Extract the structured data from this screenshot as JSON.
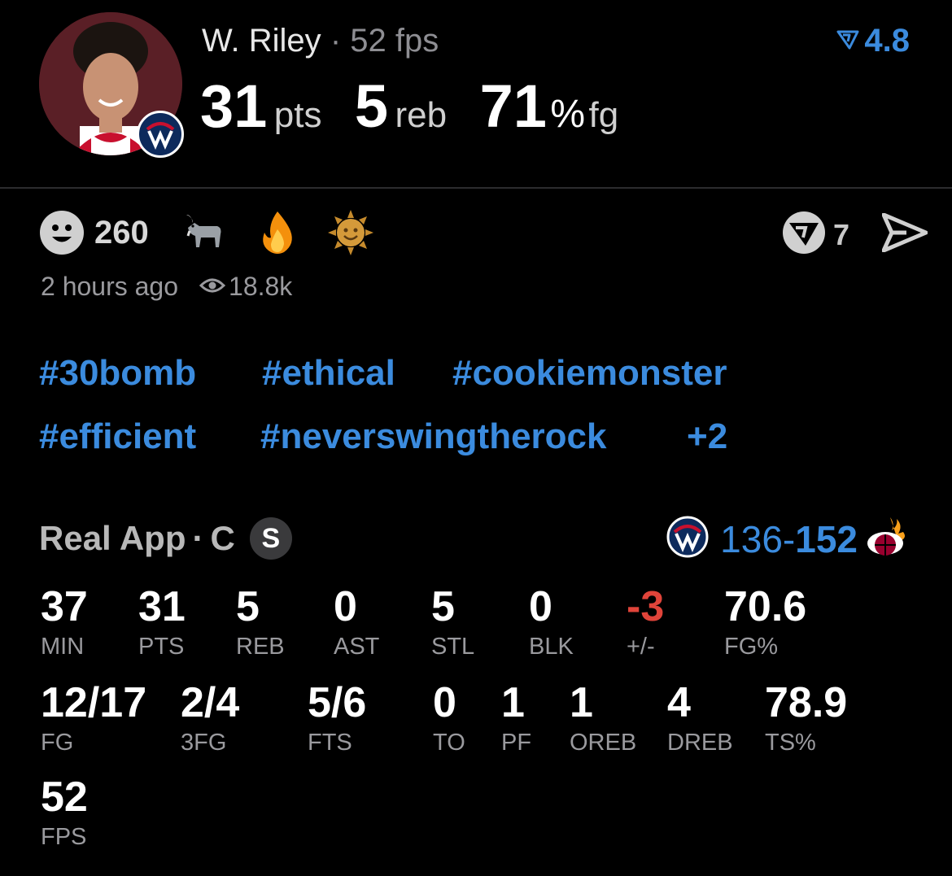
{
  "player": {
    "name": "W. Riley",
    "dot": "·",
    "fps": "52 fps",
    "rating": "4.8",
    "stats": [
      {
        "value": "31",
        "unit": "pts"
      },
      {
        "value": "5",
        "unit": "reb"
      },
      {
        "value": "71",
        "unit": "%",
        "suffix": "fg"
      }
    ]
  },
  "reactions": {
    "count": "260",
    "emojis": [
      "goat-icon",
      "fire-icon",
      "sun-icon"
    ],
    "comments": "7"
  },
  "meta": {
    "time": "2 hours ago",
    "views": "18.8k"
  },
  "tags": [
    "#30bomb",
    "#ethical",
    "#cookiemonster",
    "#efficient",
    "#neverswingtherock",
    "+2"
  ],
  "game": {
    "source": "Real App",
    "dot": "·",
    "position": "C",
    "badge": "S",
    "team_score": "136",
    "dash": "-",
    "opp_score": "152"
  },
  "box_row1": [
    {
      "value": "37",
      "label": "MIN"
    },
    {
      "value": "31",
      "label": "PTS"
    },
    {
      "value": "5",
      "label": "REB"
    },
    {
      "value": "0",
      "label": "AST"
    },
    {
      "value": "5",
      "label": "STL"
    },
    {
      "value": "0",
      "label": "BLK"
    },
    {
      "value": "-3",
      "label": "+/-"
    },
    {
      "value": "70.6",
      "label": "FG%"
    }
  ],
  "box_row2": [
    {
      "value": "12/17",
      "label": "FG"
    },
    {
      "value": "2/4",
      "label": "3FG"
    },
    {
      "value": "5/6",
      "label": "FTS"
    },
    {
      "value": "0",
      "label": "TO"
    },
    {
      "value": "1",
      "label": "PF"
    },
    {
      "value": "1",
      "label": "OREB"
    },
    {
      "value": "4",
      "label": "DREB"
    },
    {
      "value": "78.9",
      "label": "TS%"
    }
  ],
  "box_row3": [
    {
      "value": "52",
      "label": "FPS"
    }
  ],
  "colors": {
    "accent": "#3b8bde",
    "negative": "#e0443a",
    "muted": "#9a9a9e"
  }
}
